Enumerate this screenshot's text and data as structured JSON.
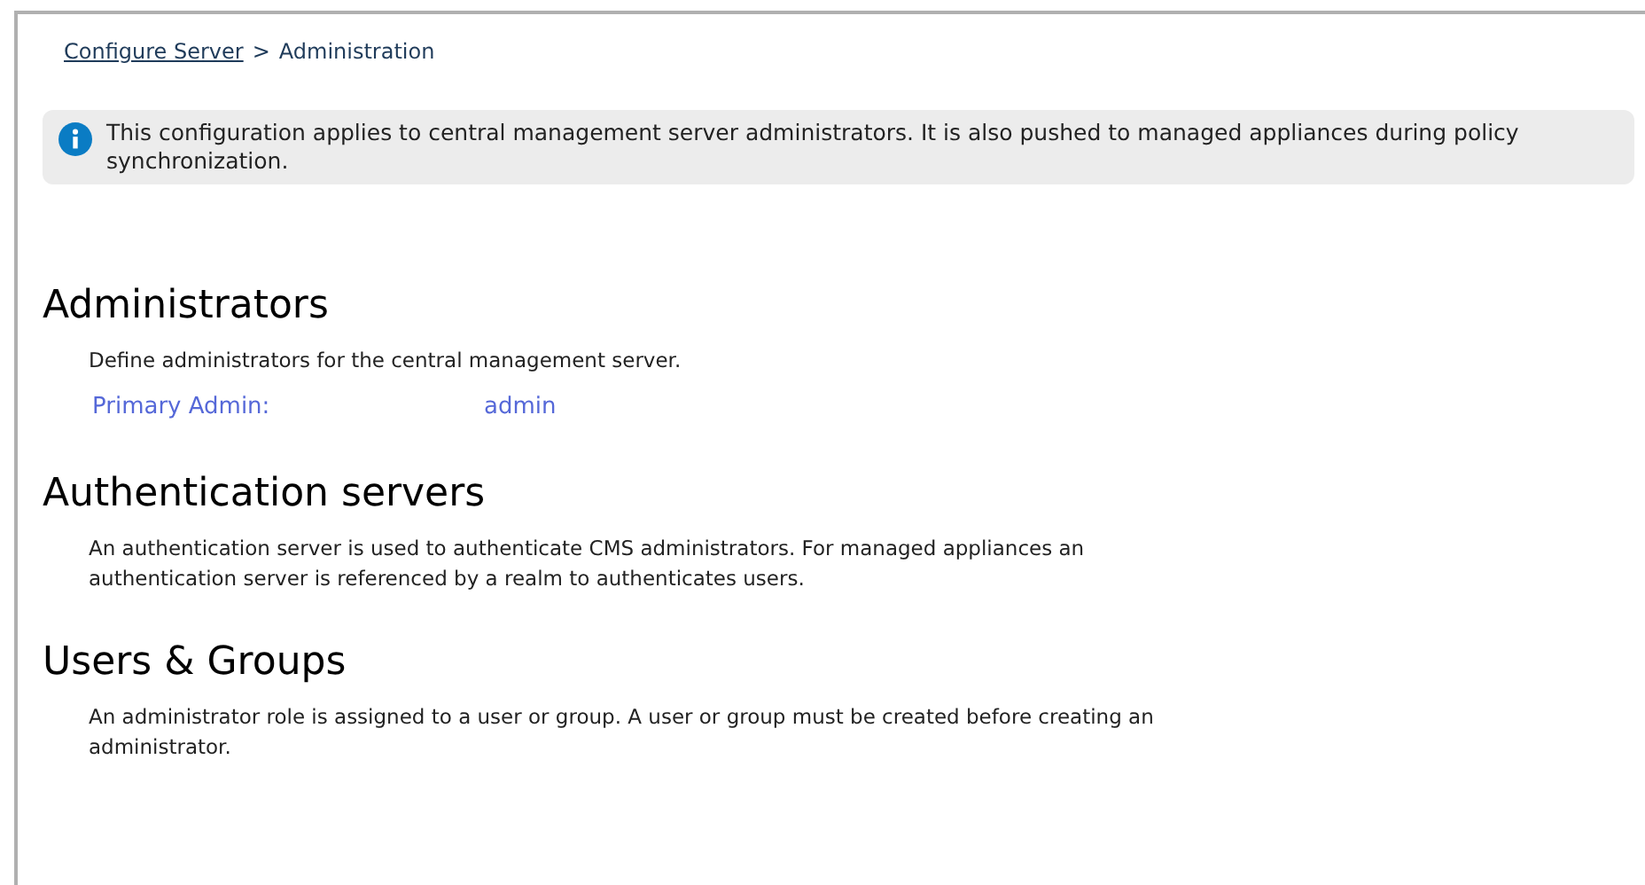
{
  "breadcrumb": {
    "link": "Configure Server",
    "separator": ">",
    "current": "Administration"
  },
  "notice": {
    "text": "This configuration applies to central management server administrators. It is also pushed to managed appliances during policy synchronization."
  },
  "sections": [
    {
      "kind": "admins",
      "title": "Administrators",
      "description": "Define administrators for the central management server.",
      "field": {
        "label": "Primary Admin:",
        "value": "admin"
      }
    },
    {
      "kind": "text",
      "title": "Authentication servers",
      "description": "An authentication server is used to authenticate CMS administrators. For managed appliances an authentication server is referenced by a realm to authenticates users."
    },
    {
      "kind": "text",
      "title": "Users & Groups",
      "description": "An administrator role is assigned to a user or group. A user or group must be created before creating an administrator."
    }
  ]
}
